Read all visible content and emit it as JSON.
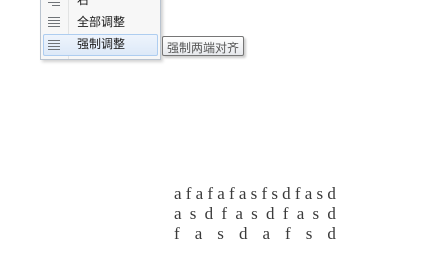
{
  "menu": {
    "items": [
      {
        "label": "右",
        "icon": "align-right-icon"
      },
      {
        "label": "全部调整",
        "icon": "justify-all-icon"
      },
      {
        "label": "强制调整",
        "icon": "force-justify-icon",
        "highlighted": true
      }
    ]
  },
  "tooltip": {
    "text": "强制两端对齐"
  },
  "document": {
    "lines": [
      "afafafasfsdfasd",
      "asdfasdfasd",
      "fasdafsd"
    ]
  },
  "colors": {
    "menu_background": "#f7f7f7",
    "menu_border": "#b9c3cf",
    "highlight_border": "#aecdf0",
    "text": "#3a3a3a"
  }
}
